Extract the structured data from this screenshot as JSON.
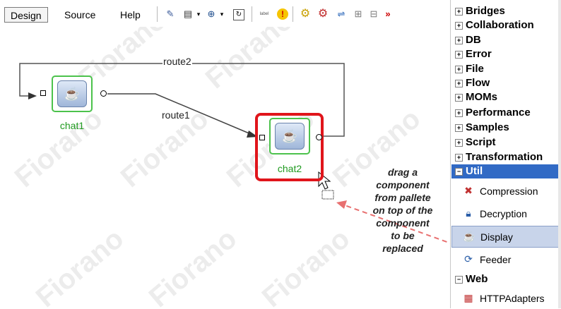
{
  "toolbar": {
    "tabs": [
      "Design",
      "Source",
      "Help"
    ],
    "active_tab": "Design",
    "icons": [
      "pencil-icon",
      "print-icon",
      "dropdown-arrow-icon",
      "zoom-icon",
      "dropdown-arrow-icon",
      "refresh-icon",
      "label-icon",
      "warning-icon",
      "gears-yellow-icon",
      "gears-red-icon",
      "connect-icon",
      "layout-icon",
      "layout-alt-icon"
    ],
    "label_icon_text": "label",
    "overflow": "»"
  },
  "canvas": {
    "watermark": "Fiorano",
    "nodes": [
      {
        "name": "chat1",
        "icon": "chat-component-icon"
      },
      {
        "name": "chat2",
        "icon": "chat-component-icon"
      }
    ],
    "routes": [
      "route1",
      "route2"
    ],
    "instruction_lines": [
      "drag a",
      "component",
      "from pallete",
      "on top of the",
      "component",
      "to be",
      "replaced"
    ],
    "highlight_color": "#e0151b",
    "arrow_color": "#e87070",
    "node_border_color": "#4cc24c"
  },
  "palette": {
    "categories": [
      "Bridges",
      "Collaboration",
      "DB",
      "Error",
      "File",
      "Flow",
      "MOMs",
      "Performance",
      "Samples",
      "Script",
      "Transformation"
    ],
    "expanded_category": "Util",
    "util_items": [
      {
        "label": "Compression",
        "icon": "compression-icon"
      },
      {
        "label": "Decryption",
        "icon": "lock-icon"
      },
      {
        "label": "Display",
        "icon": "display-icon"
      },
      {
        "label": "Feeder",
        "icon": "feeder-icon"
      }
    ],
    "selected_item": "Display",
    "web_category": "Web",
    "web_items": [
      {
        "label": "HTTPAdapters",
        "icon": "http-adapters-icon"
      }
    ],
    "collapsed_symbol": "+",
    "expanded_symbol": "−"
  }
}
